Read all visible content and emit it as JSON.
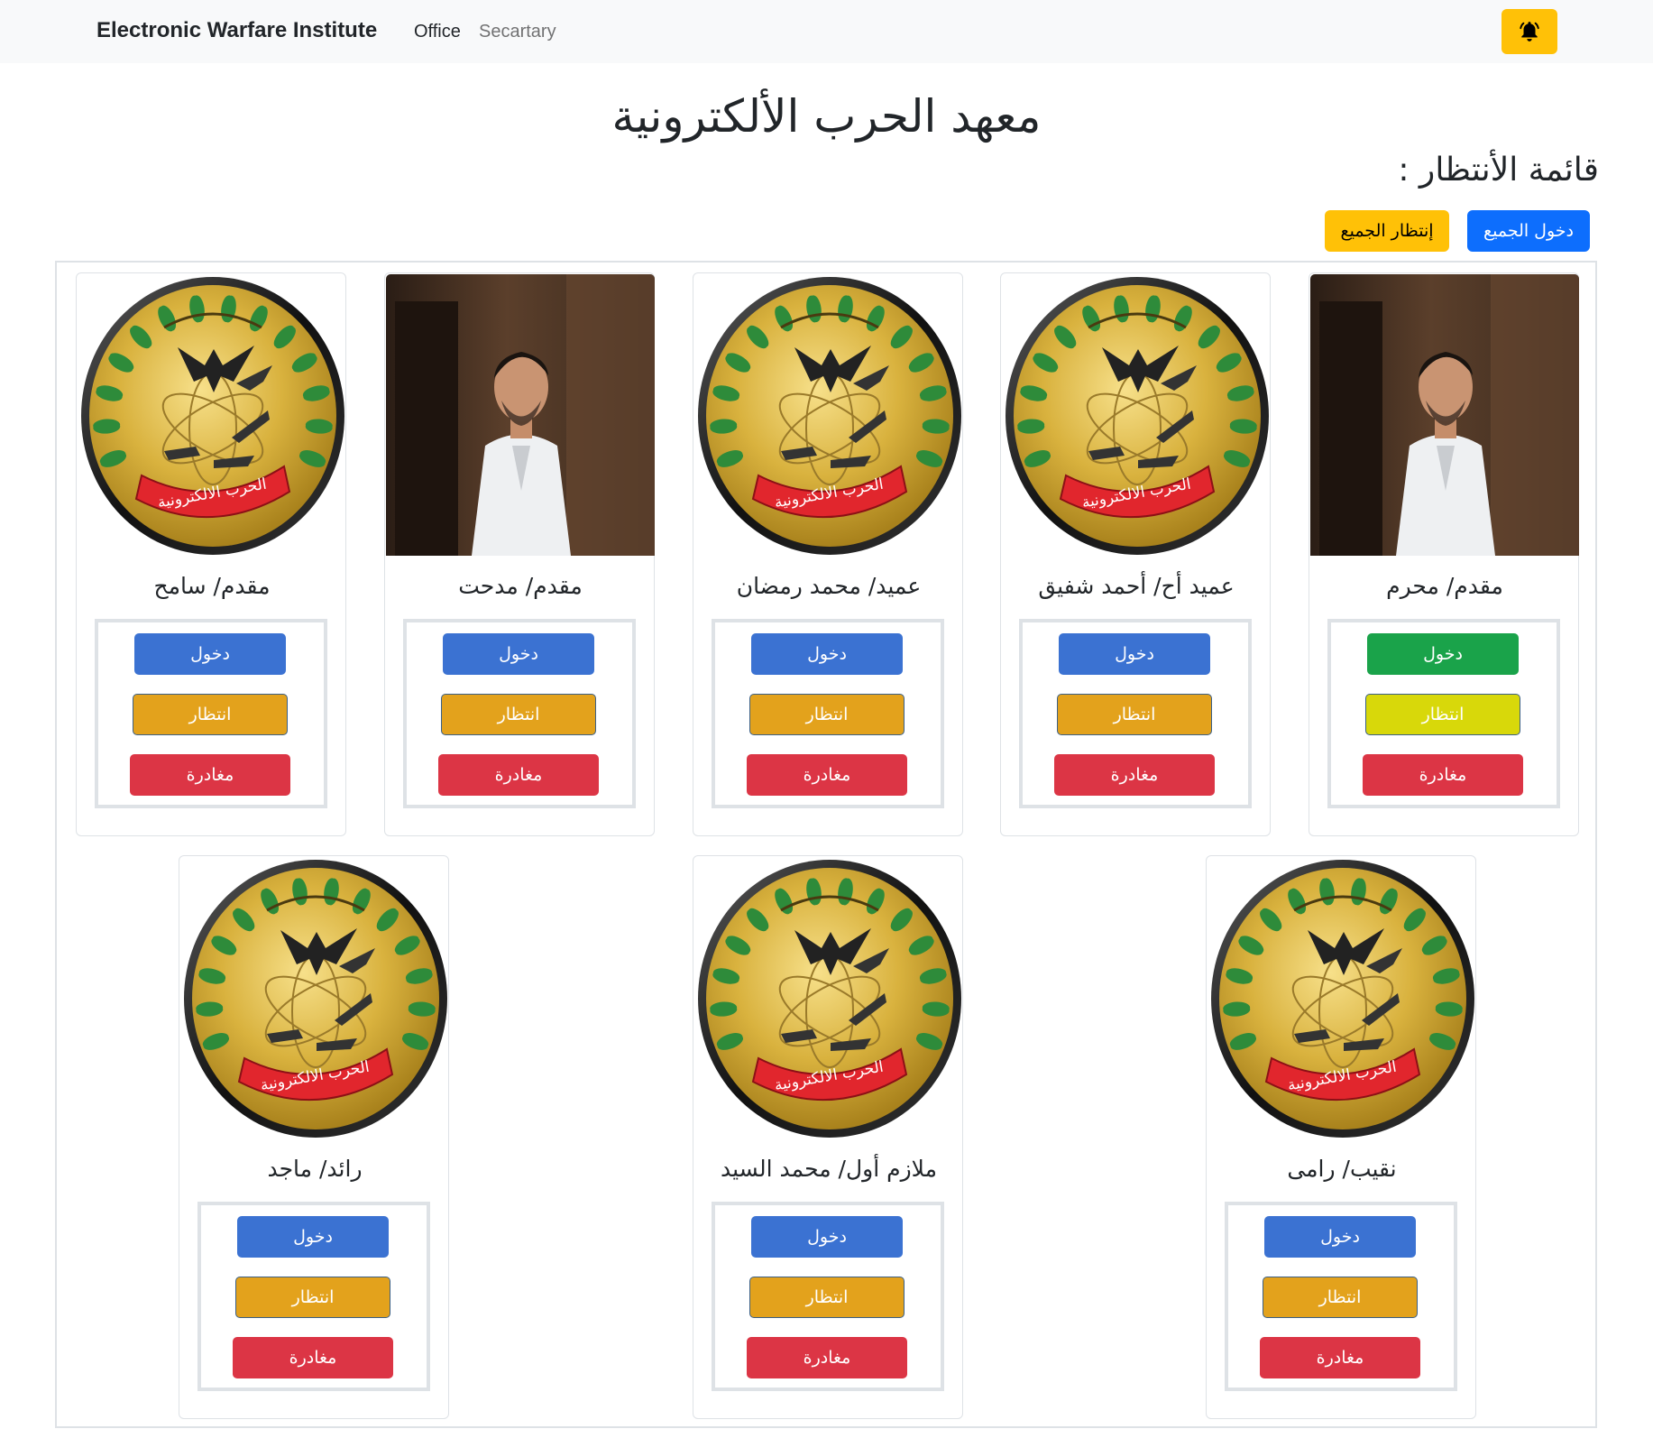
{
  "navbar": {
    "brand": "Electronic Warfare Institute",
    "links": [
      "Office",
      "Secartary"
    ]
  },
  "page": {
    "title": "معهد الحرب الألكترونية",
    "waiting_title": "قائمة الأنتظار :",
    "enter_all": "دخول الجميع",
    "wait_all": "إنتظار الجميع"
  },
  "emblem_text": "الحرب الالكترونية",
  "labels": {
    "enter": "دخول",
    "wait": "انتظار",
    "leave": "مغادرة"
  },
  "row1": [
    {
      "name": "مقدم/ سامح",
      "picture": "emblem"
    },
    {
      "name": "مقدم/ مدحت",
      "picture": "photo"
    },
    {
      "name": "عميد/ محمد رمضان",
      "picture": "emblem"
    },
    {
      "name": "عميد أح/ أحمد شفيق",
      "picture": "emblem"
    },
    {
      "name": "مقدم/ محرم",
      "picture": "photo"
    }
  ],
  "row2": [
    {
      "name": "رائد/ ماجد",
      "picture": "emblem"
    },
    {
      "name": "ملازم أول/ محمد السيد",
      "picture": "emblem"
    },
    {
      "name": "نقيب/ رامى",
      "picture": "emblem"
    }
  ],
  "colors": {
    "enter": "#3b72d2",
    "enter_active": "#1aa34a",
    "wait": "#e3a21c",
    "wait_active": "#d8d80a",
    "leave": "#dc3545",
    "bell": "#ffc107"
  },
  "icons": {
    "bell": "bell-icon"
  }
}
